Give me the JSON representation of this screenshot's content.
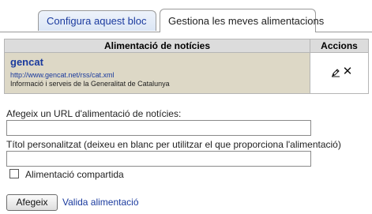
{
  "tabs": [
    {
      "label": "Configura aquest bloc",
      "active": false
    },
    {
      "label": "Gestiona les meves alimentacions",
      "active": true
    }
  ],
  "table": {
    "headers": [
      "Alimentació de notícies",
      "Accions"
    ],
    "rows": [
      {
        "title": "gencat",
        "url": "http://www.gencat.net/rss/cat.xml",
        "description": "Informació i serveis de la Generalitat de Catalunya",
        "actions": [
          "edit-icon",
          "delete-icon"
        ]
      }
    ]
  },
  "form": {
    "url_label": "Afegeix un URL d'alimentació de notícies:",
    "url_value": "",
    "title_label": "Títol personalitzat (deixeu en blanc per utilitzar el que proporciona l'alimentació)",
    "title_value": "",
    "shared_label": "Alimentació compartida",
    "shared_checked": false,
    "submit_label": "Afegeix",
    "validate_label": "Valida alimentació"
  },
  "colors": {
    "link": "#1a3a9e",
    "row_background": "#ddd8c6",
    "header_background": "#dcdcdc"
  }
}
